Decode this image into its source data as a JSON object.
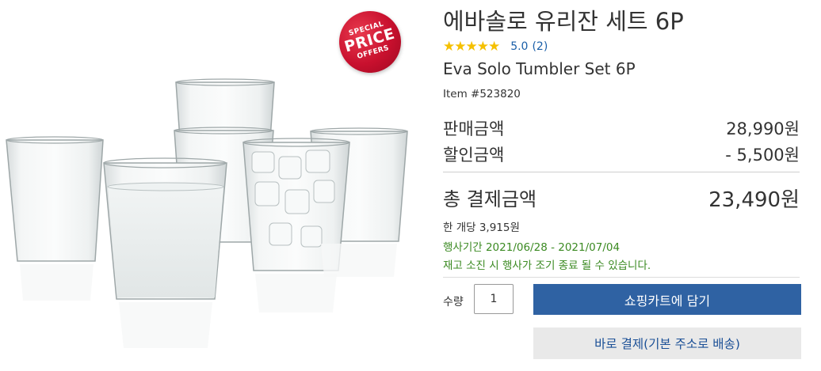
{
  "badge": {
    "line1": "SPECIAL",
    "line2": "PRICE",
    "line3": "OFFERS"
  },
  "product": {
    "title_ko": "에바솔로 유리잔 세트 6P",
    "title_en": "Eva Solo Tumbler Set 6P",
    "item_number": "Item #523820",
    "rating": {
      "stars": "★★★★★",
      "value": "5.0",
      "count": "(2)",
      "score": 5.0
    }
  },
  "pricing": {
    "sale_label": "판매금액",
    "sale_value": "28,990원",
    "discount_label": "할인금액",
    "discount_value": "- 5,500원",
    "total_label": "총 결제금액",
    "total_value": "23,490원",
    "unit_price": "한 개당 3,915원",
    "period": "행사기간 2021/06/28 - 2021/07/04",
    "notice": "재고 소진 시 행사가 조기 종료 될 수 있습니다."
  },
  "purchase": {
    "qty_label": "수량",
    "qty_value": "1",
    "add_to_cart": "쇼핑카트에 담기",
    "buy_now": "바로 결제(기본 주소로 배송)"
  },
  "colors": {
    "accent_blue": "#2f62a3",
    "promo_green": "#3b8a22",
    "badge_red": "#c8102e",
    "star_yellow": "#f5c000"
  }
}
